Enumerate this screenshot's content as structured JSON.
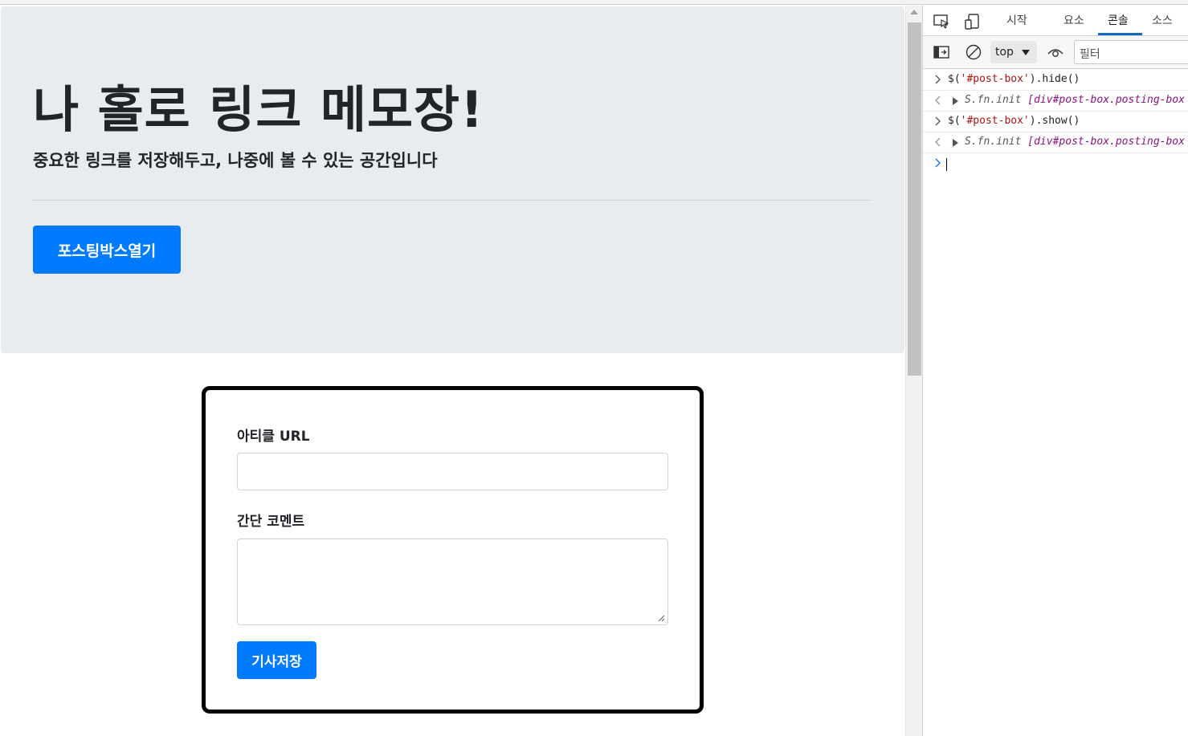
{
  "page": {
    "title": "나 홀로 링크 메모장!",
    "lead": "중요한 링크를 저장해두고, 나중에 볼 수 있는 공간입니다",
    "open_button": "포스팅박스열기",
    "form": {
      "url_label": "아티클 URL",
      "url_value": "",
      "comment_label": "간단 코멘트",
      "comment_value": "",
      "save_button": "기사저장"
    }
  },
  "devtools": {
    "tabs": [
      "시작",
      "요소",
      "콘솔",
      "소스"
    ],
    "active_tab": "콘솔",
    "context": "top",
    "filter_placeholder": "필터",
    "console": [
      {
        "type": "input",
        "pre": "$(",
        "str": "'#post-box'",
        "post": ").hide()"
      },
      {
        "type": "output",
        "text": "S.fn.init ",
        "obj": "[div#post-box.posting-box"
      },
      {
        "type": "input",
        "pre": "$(",
        "str": "'#post-box'",
        "post": ").show()"
      },
      {
        "type": "output",
        "text": "S.fn.init ",
        "obj": "[div#post-box.posting-box"
      }
    ]
  },
  "colors": {
    "primary": "#007bff",
    "jumbotron_bg": "#e9ecef",
    "text": "#212529",
    "devtools_accent": "#0f6cbd"
  }
}
